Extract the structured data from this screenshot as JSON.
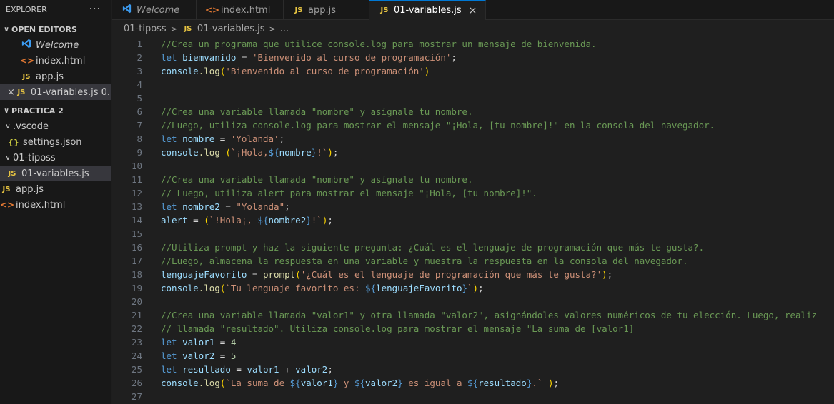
{
  "explorer": {
    "title": "EXPLORER",
    "more": "···",
    "open_editors": {
      "label": "OPEN EDITORS",
      "items": [
        {
          "icon": "vscode-icon",
          "label": "Welcome"
        },
        {
          "icon": "html-icon",
          "label": "index.html"
        },
        {
          "icon": "js-icon",
          "label": "app.js"
        },
        {
          "icon": "js-icon",
          "label": "01-variables.js 0..."
        }
      ]
    },
    "workspace": {
      "label": "PRACTICA 2",
      "vscode_folder": ".vscode",
      "settings": "settings.json",
      "tiposs_folder": "01-tiposs",
      "variables_file": "01-variables.js",
      "appjs": "app.js",
      "indexhtml": "index.html"
    }
  },
  "tabs": [
    {
      "label": "Welcome"
    },
    {
      "label": "index.html"
    },
    {
      "label": "app.js"
    },
    {
      "label": "01-variables.js"
    }
  ],
  "breadcrumb": {
    "folder": "01-tiposs",
    "file": "01-variables.js",
    "more": "..."
  },
  "icons": {
    "js": "JS",
    "html": "<>",
    "json": "{}",
    "close": "×",
    "chevron_down": "∨",
    "chevron_right": ">"
  },
  "code": {
    "line_numbers": [
      "1",
      "2",
      "3",
      "4",
      "5",
      "6",
      "7",
      "8",
      "9",
      "10",
      "11",
      "12",
      "13",
      "14",
      "15",
      "16",
      "17",
      "18",
      "19",
      "20",
      "21",
      "22",
      "23",
      "24",
      "25",
      "26",
      "27"
    ],
    "l1": "//Crea un programa que utilice console.log para mostrar un mensaje de bienvenida.",
    "l2_kw": "let",
    "l2_var": "biemvanido",
    "l2_eq": " = ",
    "l2_str": "'Bienvenido al curso de programación'",
    "l2_end": ";",
    "l3_obj": "console",
    "l3_fn": ".log",
    "l3_str": "'Bienvenido al curso de programación'",
    "l6": "//Crea una variable llamada \"nombre\" y asígnale tu nombre.",
    "l7": "//Luego, utiliza console.log para mostrar el mensaje \"¡Hola, [tu nombre]!\" en la consola del navegador.",
    "l8_kw": "let",
    "l8_var": "nombre",
    "l8_str": "'Yolanda'",
    "l9_obj": "console",
    "l9_fn": ".log",
    "l9_a": "`¡Hola,",
    "l9_open": "${",
    "l9_v": "nombre",
    "l9_close": "}",
    "l9_b": "!`",
    "l11": "//Crea una variable llamada \"nombre\" y asígnale tu nombre.",
    "l12": "// Luego, utiliza alert para mostrar el mensaje \"¡Hola, [tu nombre]!\".",
    "l13_kw": "let",
    "l13_var": "nombre2",
    "l13_str": "\"Yolanda\"",
    "l14_var": "alert",
    "l14_a": "`!Hola¡, ",
    "l14_open": "${",
    "l14_v": "nombre2",
    "l14_close": "}",
    "l14_b": "!`",
    "l16": "//Utiliza prompt y haz la siguiente pregunta: ¿Cuál es el lenguaje de programación que más te gusta?.",
    "l17": "//Luego, almacena la respuesta en una variable y muestra la respuesta en la consola del navegador.",
    "l18_var": "lenguajeFavorito",
    "l18_fn": "prompt",
    "l18_str": "'¿Cuál es el lenguaje de programación que más te gusta?'",
    "l19_obj": "console",
    "l19_fn": ".log",
    "l19_a": "`Tu lenguaje favorito es: ",
    "l19_open": "${",
    "l19_v": "lenguajeFavorito",
    "l19_close": "}",
    "l19_b": "`",
    "l21": "//Crea una variable llamada \"valor1\" y otra llamada \"valor2\", asignándoles valores numéricos de tu elección. Luego, realiz",
    "l22": "// llamada \"resultado\". Utiliza console.log para mostrar el mensaje \"La suma de [valor1]",
    "l23_kw": "let",
    "l23_var": "valor1",
    "l23_num": "4",
    "l24_kw": "let",
    "l24_var": "valor2",
    "l24_num": "5",
    "l25_kw": "let",
    "l25_var": "resultado",
    "l25_a": "valor1",
    "l25_op": " + ",
    "l25_b": "valor2",
    "l26_obj": "console",
    "l26_fn": ".log",
    "l26_s1": "`La suma de ",
    "l26_v1": "valor1",
    "l26_s2": " y ",
    "l26_v2": "valor2",
    "l26_s3": " es igual a ",
    "l26_v3": "resultado",
    "l26_s4": ".` ",
    "tpl_open": "${",
    "tpl_close": "}"
  }
}
